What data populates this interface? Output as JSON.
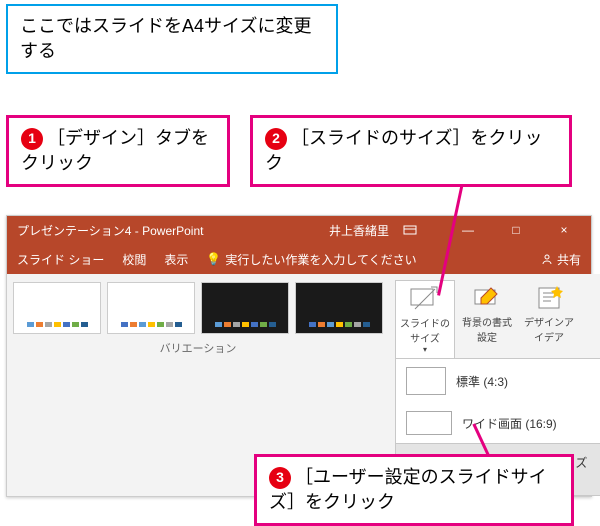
{
  "intro": "ここではスライドをA4サイズに変更する",
  "steps": {
    "s1": "［デザイン］タブをクリック",
    "s2": "［スライドのサイズ］をクリック",
    "s3": "［ユーザー設定のスライドサイズ］をクリック"
  },
  "titlebar": {
    "title": "プレゼンテーション4 - PowerPoint",
    "user": "井上香緒里",
    "btn_ribbon": "⬜",
    "btn_min": "—",
    "btn_max": "□",
    "btn_close": "×"
  },
  "ribbon": {
    "tabs": [
      "スライド ショー",
      "校閲",
      "表示"
    ],
    "tellme": "実行したい作業を入力してください",
    "share": "共有"
  },
  "variations": {
    "label": "バリエーション"
  },
  "right_buttons": {
    "slide_size": "スライドのサイズ",
    "bg_format": "背景の書式設定",
    "design_ideas": "デザインアイデア"
  },
  "dropdown": {
    "standard": "標準 (4:3)",
    "wide": "ワイド画面 (16:9)",
    "custom": "ユーザー設定のスライドのサイズ(C)..."
  }
}
